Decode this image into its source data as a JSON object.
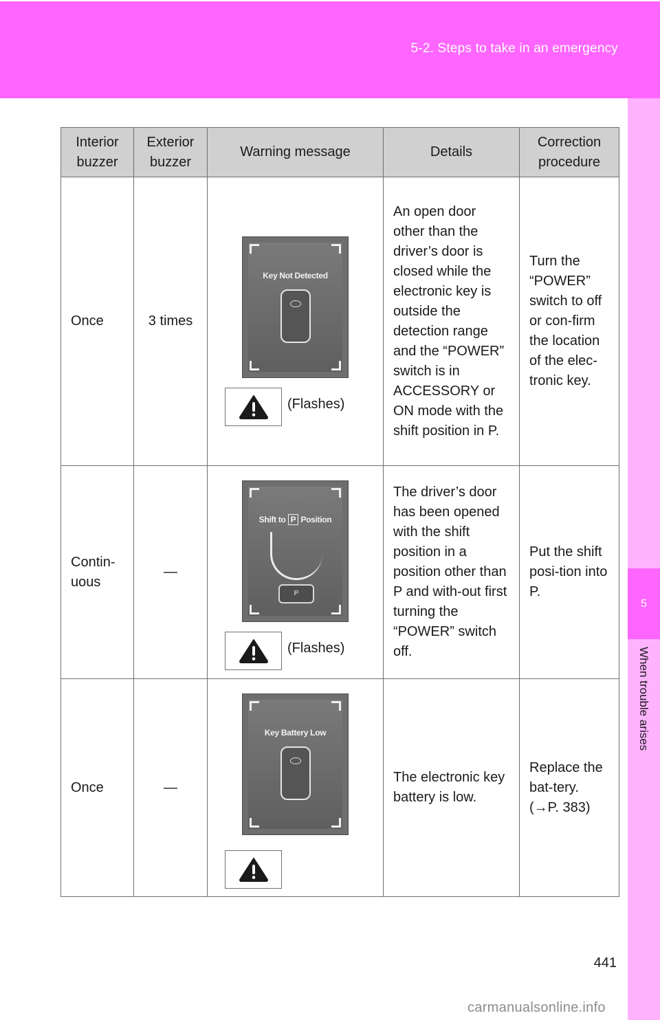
{
  "header": {
    "section_title": "5-2. Steps to take in an emergency",
    "accent_color": "#ff66ff"
  },
  "side_tab": {
    "chapter_number": "5",
    "chapter_label": "When trouble arises",
    "tab_color": "#ffb3ff"
  },
  "table": {
    "columns": [
      {
        "line1": "Interior",
        "line2": "buzzer"
      },
      {
        "line1": "Exterior",
        "line2": "buzzer"
      },
      {
        "line1": "Warning message",
        "line2": ""
      },
      {
        "line1": "Details",
        "line2": ""
      },
      {
        "line1": "Correction",
        "line2": "procedure"
      }
    ],
    "rows": [
      {
        "interior_buzzer": "Once",
        "exterior_buzzer": "3 times",
        "display_message": "Key Not Detected",
        "display_icon": "key-fob-icon",
        "warning_light_icon": "warning-triangle-icon",
        "warning_light_note": "(Flashes)",
        "details": "An open door other than the driver’s door is closed while the electronic key is outside the detection range and the “POWER” switch is in ACCESSORY or ON mode with the shift position in P.",
        "correction": "Turn the “POWER” switch to off or con-firm the location of the elec-tronic key."
      },
      {
        "interior_buzzer": "Contin-uous",
        "exterior_buzzer": "—",
        "display_message_prefix": "Shift to",
        "display_message_badge": "P",
        "display_message_suffix": "Position",
        "display_icon": "shift-lever-icon",
        "display_button_label": "P",
        "warning_light_icon": "warning-triangle-icon",
        "warning_light_note": "(Flashes)",
        "details": "The driver’s door has been opened with the shift position in a position other than P and with-out first turning the “POWER” switch off.",
        "correction": "Put the shift posi-tion into P."
      },
      {
        "interior_buzzer": "Once",
        "exterior_buzzer": "—",
        "display_message": "Key Battery Low",
        "display_icon": "key-fob-icon",
        "warning_light_icon": "warning-triangle-icon",
        "warning_light_note": "",
        "details": "The electronic key battery is low.",
        "correction": "Replace the bat-tery. (→P. 383)"
      }
    ]
  },
  "footer": {
    "page_number": "441",
    "watermark": "carmanualsonline.info"
  }
}
